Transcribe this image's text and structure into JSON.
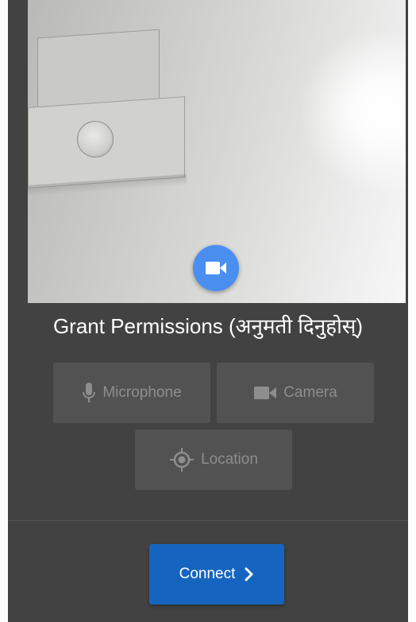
{
  "preview": {
    "camera_button_icon": "videocam-icon"
  },
  "permissions": {
    "title": "Grant Permissions (अनुमती दिनुहोस्)",
    "microphone": {
      "label": "Microphone",
      "icon": "microphone-icon"
    },
    "camera": {
      "label": "Camera",
      "icon": "videocam-icon"
    },
    "location": {
      "label": "Location",
      "icon": "location-target-icon"
    }
  },
  "connect": {
    "label": "Connect",
    "icon": "chevron-right-icon"
  },
  "colors": {
    "background": "#424242",
    "permission_button": "#525252",
    "permission_text": "#8e8e8e",
    "camera_fab": "#4a8ef0",
    "connect_button": "#1565c0"
  }
}
